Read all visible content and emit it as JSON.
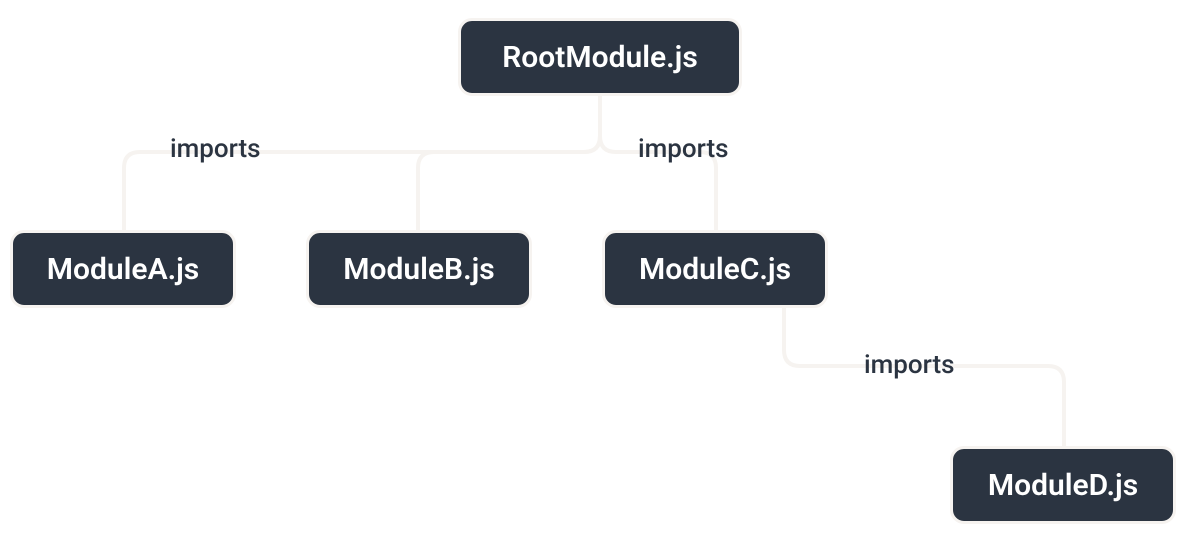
{
  "nodes": {
    "root": {
      "label": "RootModule.js"
    },
    "moduleA": {
      "label": "ModuleA.js"
    },
    "moduleB": {
      "label": "ModuleB.js"
    },
    "moduleC": {
      "label": "ModuleC.js"
    },
    "moduleD": {
      "label": "ModuleD.js"
    }
  },
  "edgeLabels": {
    "rootToA": "imports",
    "rootToC": "imports",
    "cToD": "imports"
  }
}
